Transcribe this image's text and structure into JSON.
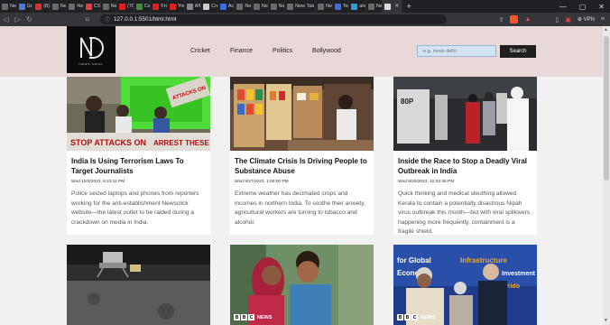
{
  "browser": {
    "tabs": [
      {
        "title": "New",
        "color": "#6a6a6a"
      },
      {
        "title": "Grai",
        "color": "#4a7bd8"
      },
      {
        "title": "(8) F",
        "color": "#e03030"
      },
      {
        "title": "New",
        "color": "#6a6a6a"
      },
      {
        "title": "New",
        "color": "#6a6a6a"
      },
      {
        "title": "CSS",
        "color": "#e04040"
      },
      {
        "title": "New",
        "color": "#6a6a6a"
      },
      {
        "title": "(70)",
        "color": "#e02020"
      },
      {
        "title": "Cav",
        "color": "#3a8f3a"
      },
      {
        "title": "Fron",
        "color": "#e02020"
      },
      {
        "title": "You",
        "color": "#e02020"
      },
      {
        "title": "Wh",
        "color": "#888888"
      },
      {
        "title": "Cre",
        "color": "#cccccc"
      },
      {
        "title": "Acc",
        "color": "#3b6ed8"
      },
      {
        "title": "New",
        "color": "#6a6a6a"
      },
      {
        "title": "New",
        "color": "#6a6a6a"
      },
      {
        "title": "New",
        "color": "#6a6a6a"
      },
      {
        "title": "New Tab",
        "color": "#6a6a6a"
      },
      {
        "title": "New",
        "color": "#6a6a6a"
      },
      {
        "title": "Tem",
        "color": "#3b6ed8"
      },
      {
        "title": "alvic",
        "color": "#2a9fd8"
      },
      {
        "title": "New",
        "color": "#6a6a6a"
      },
      {
        "title": "",
        "color": "#dddddd"
      }
    ],
    "new_tab": "+",
    "win_controls": [
      "—",
      "▢",
      "✕"
    ],
    "url": "127.0.0.1:5501/html.html",
    "vpn_label": "VPN"
  },
  "site": {
    "logo_tagline": "NEWS DESK",
    "nav": [
      "Cricket",
      "Finance",
      "Politics",
      "Bollywood"
    ],
    "search_placeholder": "e.g. news delhi",
    "search_button": "Search"
  },
  "articles": [
    {
      "title": "India Is Using Terrorism Laws To Target Journalists",
      "date": "Wed 10/3/2023, 6:23:11 PM",
      "desc": "Police seized laptops and phones from reporters working for the anti-establishment Newsclick website—the latest outlet to be raided during a crackdown on media in India."
    },
    {
      "title": "The Climate Crisis Is Driving People to Substance Abuse",
      "date": "Wed 9/27/2023, 1:00:00 PM",
      "desc": "Extreme weather has decimated crops and incomes in northern India. To soothe their anxiety, agricultural workers are turning to tobacco and alcohol."
    },
    {
      "title": "Inside the Race to Stop a Deadly Viral Outbreak in India",
      "date": "Wed 9/20/2023, 10:33:46 PM",
      "desc": "Quick thinking and medical sleuthing allowed Kerala to contain a potentially disastrous Nipah virus outbreak this month—but with viral spillovers happening more frequently, containment is a fragile shield."
    },
    {
      "image_label": "moon-lander"
    },
    {
      "image_label": "mother-and-child",
      "badge": "NEWS"
    },
    {
      "image_label": "world-leaders",
      "badge": "NEWS"
    }
  ]
}
